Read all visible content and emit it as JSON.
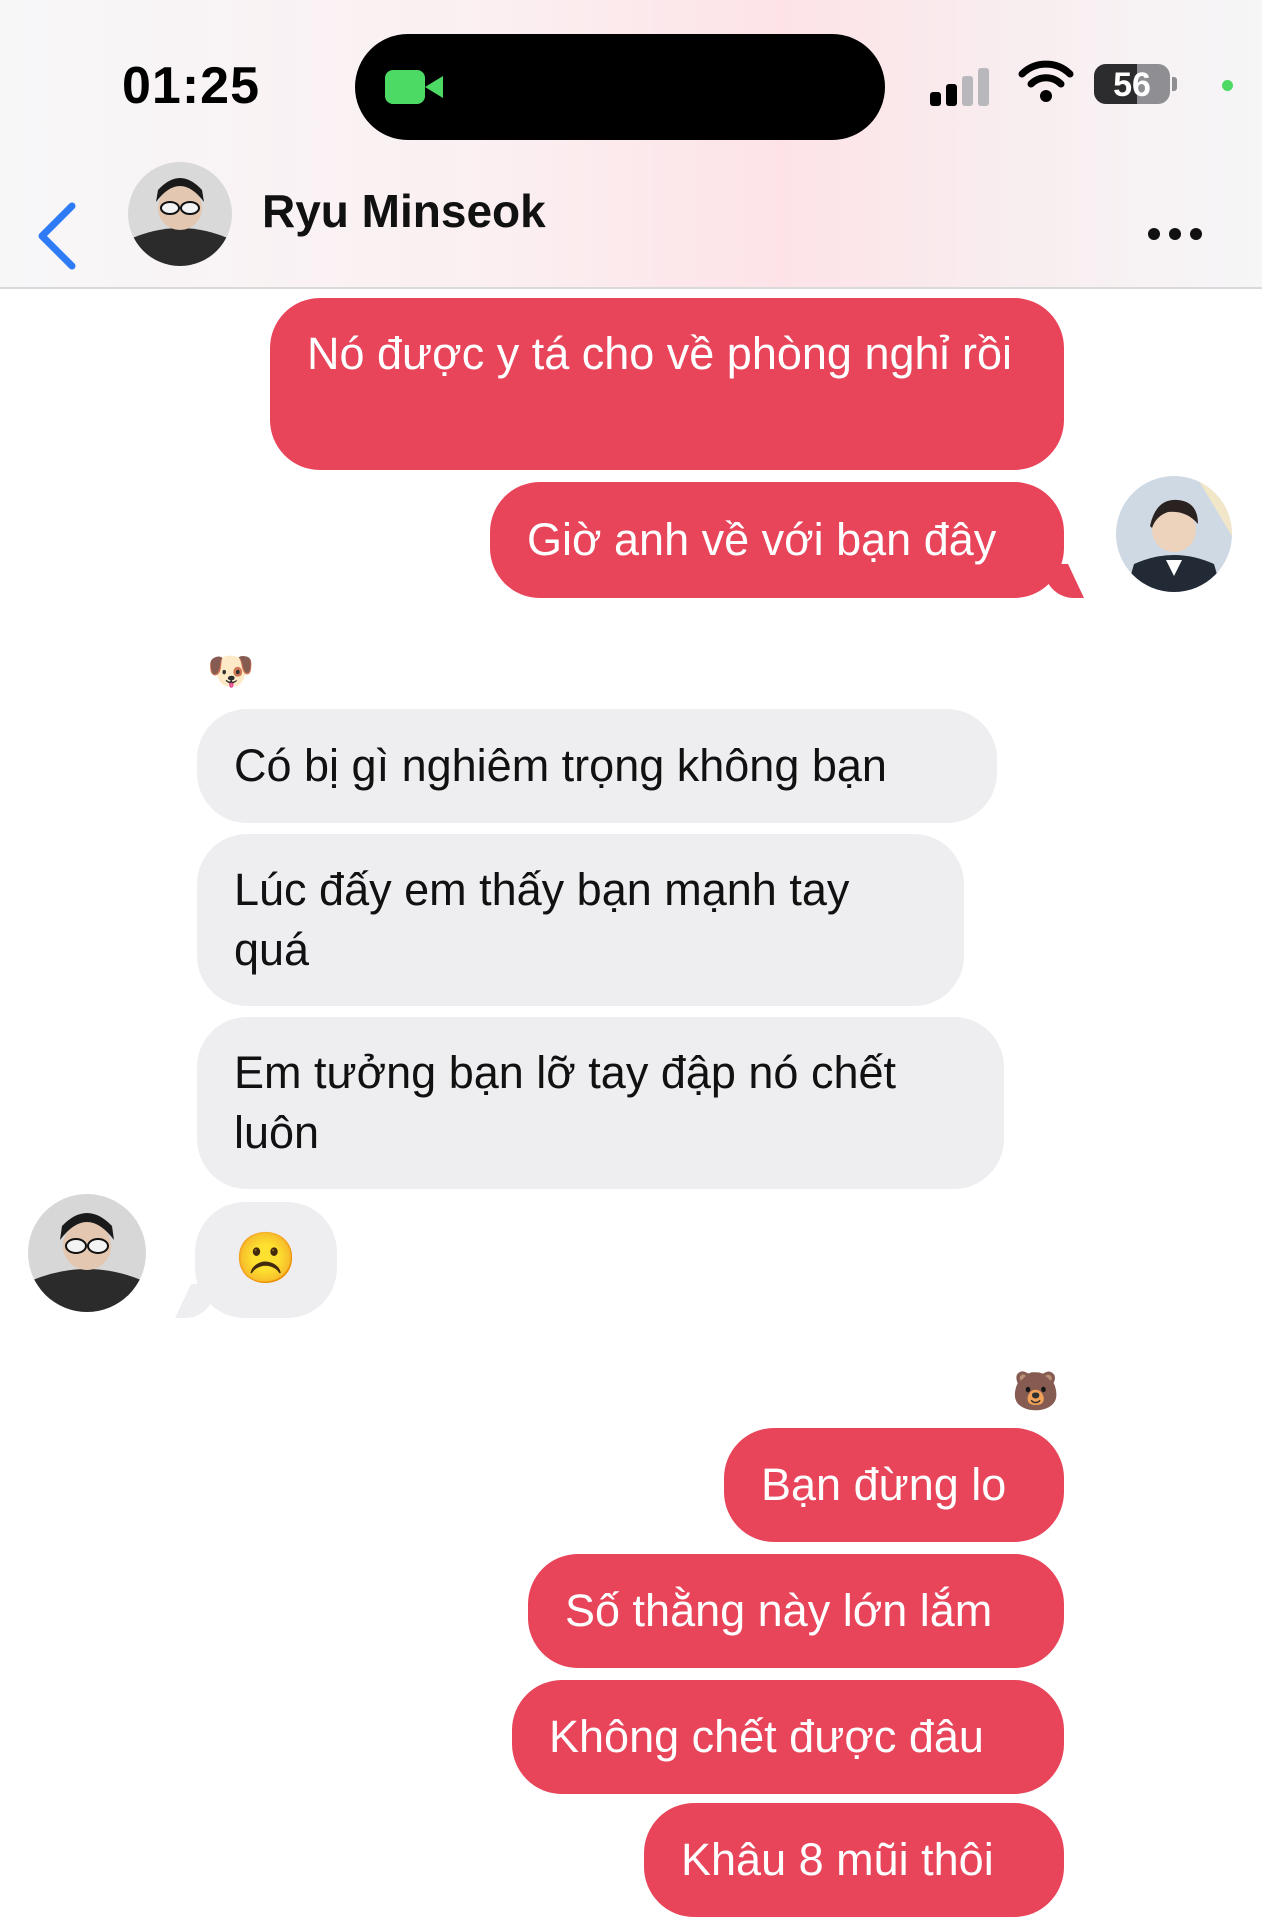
{
  "status_bar": {
    "time": "01:25",
    "battery": "56",
    "battery_level": 0.56
  },
  "header": {
    "back_label": "",
    "contact_name": "Ryu Minseok"
  },
  "messages": [
    {
      "side": "out",
      "text": "Nó được y tá cho về phòng nghỉ rồi"
    },
    {
      "side": "out",
      "text": "Giờ anh về với bạn đây"
    },
    {
      "side": "in",
      "reaction": "🐶",
      "text": "Có bị gì nghiêm trọng không bạn"
    },
    {
      "side": "in",
      "text": "Lúc đấy em thấy bạn mạnh tay quá"
    },
    {
      "side": "in",
      "text": "Em tưởng bạn lỡ tay đập nó chết luôn"
    },
    {
      "side": "in",
      "text": "☹️"
    },
    {
      "side": "out",
      "reaction": "🐻",
      "text": "Bạn đừng lo"
    },
    {
      "side": "out",
      "text": "Số thằng này lớn lắm"
    },
    {
      "side": "out",
      "text": "Không chết được đâu"
    },
    {
      "side": "out",
      "text": "Khâu 8 mũi thôi"
    }
  ],
  "colors": {
    "outgoing": "#e8445a",
    "incoming": "#eeeef1",
    "accent": "#2f7bf5"
  },
  "icons": [
    "video-camera-icon",
    "cellular-signal-icon",
    "wifi-icon",
    "battery-icon",
    "back-chevron-icon",
    "more-icon"
  ]
}
